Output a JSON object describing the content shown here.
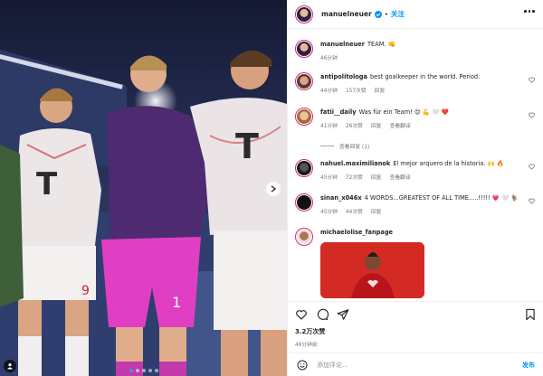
{
  "header": {
    "username": "manuelneuer",
    "separator": "•",
    "follow_label": "关注"
  },
  "caption": {
    "username": "manuelneuer",
    "text": "TEAM. 👊",
    "time": "46分钟"
  },
  "comments": [
    {
      "username": "antipolitologa",
      "text": "best goalkeeper in the world. Period.",
      "time": "44分钟",
      "likes": "157次赞",
      "reply_label": "回复"
    },
    {
      "username": "fatii__daily",
      "text": "Was für ein Team! 😍 💪 🤍 ❤️",
      "time": "41分钟",
      "likes": "26次赞",
      "reply_label": "回复",
      "translate_label": "查看翻译"
    },
    {
      "username": "nahuel.maximilianok",
      "text": "El mejor arquero de la historia. 🙌 🔥",
      "time": "45分钟",
      "likes": "72次赞",
      "reply_label": "回复",
      "translate_label": "查看翻译"
    },
    {
      "username": "sinan_x046x",
      "text": "4 WORDS...GREATEST OF ALL TIME.....!!!!! 💗 🤍 🐐",
      "time": "45分钟",
      "likes": "44次赞",
      "reply_label": "回复"
    },
    {
      "username": "michaelolise_fanpage",
      "text": ""
    }
  ],
  "view_replies": "查看回复 (1)",
  "likes_count": "3.2万次赞",
  "post_time": "46分钟前",
  "comment_box": {
    "placeholder": "添加评论...",
    "post_label": "发布"
  },
  "photo": {
    "jersey_number": "1",
    "jersey_logo": "T",
    "short_number": "9"
  },
  "icons": [
    "verified-badge",
    "more-options",
    "heart",
    "comment",
    "share",
    "bookmark",
    "emoji",
    "next-arrow",
    "user-tag"
  ],
  "colors": {
    "accent": "#0095f6",
    "text": "#262626",
    "muted": "#737373",
    "carousel_active": "#3897f0"
  }
}
